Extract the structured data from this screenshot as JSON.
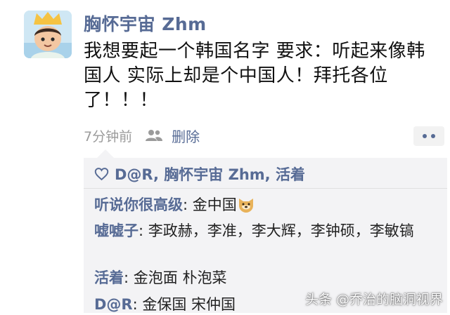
{
  "post": {
    "username": "胸怀宇宙 Zhm",
    "text_lines": [
      "我想要起一个韩国名字 要求：听起来像韩",
      "国人 实际上却是个中国人！拜托各位",
      "了！！！"
    ],
    "time": "7分钟前",
    "delete_label": "删除"
  },
  "likes": {
    "names": "D@R, 胸怀宇宙 Zhm, 活着"
  },
  "comments": [
    {
      "author": "听说你很高级",
      "sep": ": ",
      "text": "金中国"
    },
    {
      "author": "嘘嘘子",
      "sep": ": ",
      "text": "李政赫，李准，李大辉，李钟硕，李敏镐"
    },
    {
      "author": "活着",
      "sep": ": ",
      "text": "金泡面 朴泡菜"
    },
    {
      "author": "D@R",
      "sep": ": ",
      "text": "金保国 宋仲国"
    }
  ],
  "watermark": "头条 @乔治的脑洞视界",
  "colors": {
    "link": "#576b95",
    "panel": "#f3f3f5",
    "meta": "#9b9b9b"
  },
  "icons": [
    "avatar",
    "people-icon",
    "more-icon",
    "heart-icon",
    "dog-emoji-icon"
  ]
}
